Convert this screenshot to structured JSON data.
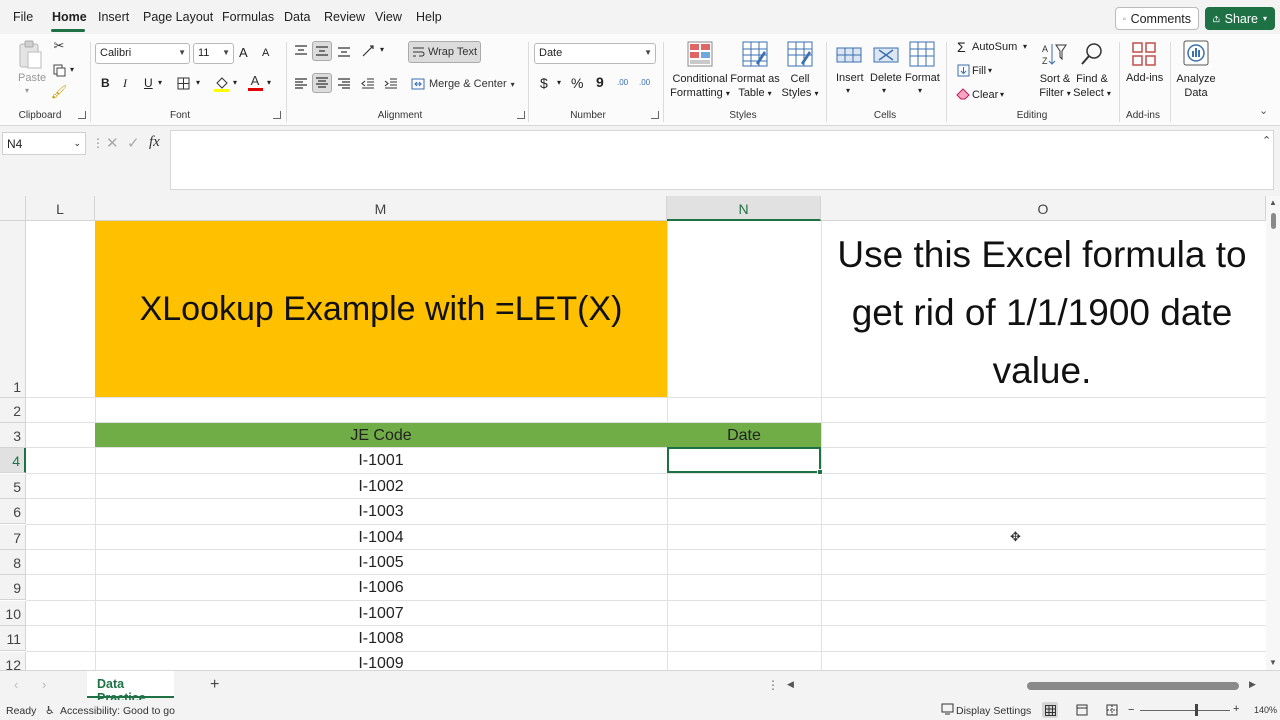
{
  "menu": {
    "tabs": [
      "File",
      "Home",
      "Insert",
      "Page Layout",
      "Formulas",
      "Data",
      "Review",
      "View",
      "Help"
    ],
    "active_tab": "Home",
    "comments_label": "Comments",
    "share_label": "Share"
  },
  "ribbon": {
    "clipboard": {
      "paste_label": "Paste",
      "group_label": "Clipboard"
    },
    "font": {
      "font_name": "Calibri",
      "font_size": "11",
      "bold": "B",
      "italic": "I",
      "underline": "U",
      "grow": "A",
      "shrink": "A",
      "font_color_letter": "A",
      "group_label": "Font"
    },
    "alignment": {
      "wrap_text": "Wrap Text",
      "merge_center": "Merge & Center",
      "group_label": "Alignment"
    },
    "number": {
      "format": "Date",
      "currency": "$",
      "percent": "%",
      "comma": "9",
      "inc_decimal": ".00",
      "dec_decimal": ".00",
      "group_label": "Number"
    },
    "styles": {
      "conditional": "Conditional",
      "conditional2": "Formatting",
      "format_as": "Format as",
      "format_as2": "Table",
      "cell_styles": "Cell",
      "cell_styles2": "Styles",
      "group_label": "Styles"
    },
    "cells": {
      "insert": "Insert",
      "delete": "Delete",
      "format": "Format",
      "group_label": "Cells"
    },
    "editing": {
      "autosum": "AutoSum",
      "fill": "Fill",
      "clear": "Clear",
      "sort_filter": "Sort &",
      "sort_filter2": "Filter",
      "find_select": "Find &",
      "find_select2": "Select",
      "group_label": "Editing"
    },
    "addins": {
      "addins": "Add-ins",
      "group_label": "Add-ins"
    },
    "analyze": {
      "analyze": "Analyze",
      "analyze2": "Data"
    }
  },
  "formula_bar": {
    "name_box": "N4",
    "fx": "fx",
    "formula": ""
  },
  "grid": {
    "columns": [
      "L",
      "M",
      "N",
      "O"
    ],
    "selected_column": "N",
    "row_numbers": [
      "1",
      "2",
      "3",
      "4",
      "5",
      "6",
      "7",
      "8",
      "9",
      "10",
      "11",
      "12"
    ],
    "selected_row": "4",
    "title_cell": "XLookup Example with =LET(X)",
    "note_cell": "Use this Excel formula to get rid of 1/1/1900 date value.",
    "headers": {
      "je_code": "JE Code",
      "date": "Date"
    },
    "je_codes": [
      "I-1001",
      "I-1002",
      "I-1003",
      "I-1004",
      "I-1005",
      "I-1006",
      "I-1007",
      "I-1008",
      "I-1009"
    ]
  },
  "sheets": {
    "active": "Data Practice",
    "add": "+"
  },
  "status": {
    "ready": "Ready",
    "accessibility": "Accessibility: Good to go",
    "display_settings": "Display Settings",
    "zoom": "140%"
  },
  "colors": {
    "accent": "#1e7145",
    "title_fill": "#ffc000",
    "header_fill": "#70ad47"
  }
}
